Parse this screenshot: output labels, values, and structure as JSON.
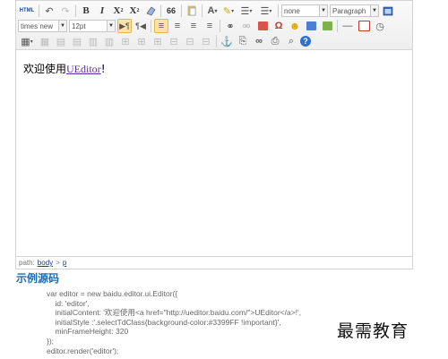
{
  "toolbar": {
    "source_label": "HTML",
    "quote_label": "66",
    "font_family": "times new",
    "font_size": "12pt",
    "heading_style": "none",
    "paragraph_format": "Paragraph"
  },
  "content": {
    "text_before": "欢迎使用",
    "link_text": "UEditor",
    "text_after": "!"
  },
  "pathbar": {
    "label": "path:",
    "crumb_body": "body",
    "separator": ">",
    "crumb_p": "p"
  },
  "section": {
    "title": "示例源码"
  },
  "code_lines": [
    "var editor = new baidu.editor.ui.Editor({",
    "    id: 'editor',",
    "    initialContent: '欢迎使用<a href=\"http://ueditor.baidu.com/\">UEditor</a>!',",
    "    initialStyle :'.selectTdClass{background-color:#3399FF !important}',",
    "    minFrameHeight: 320",
    "});",
    "editor.render('editor');"
  ],
  "watermark": "最需教育",
  "colors": {
    "accent_blue": "#1b6cb3",
    "active_highlight": "#fbe3a7",
    "link_purple": "#5a2ca0"
  }
}
